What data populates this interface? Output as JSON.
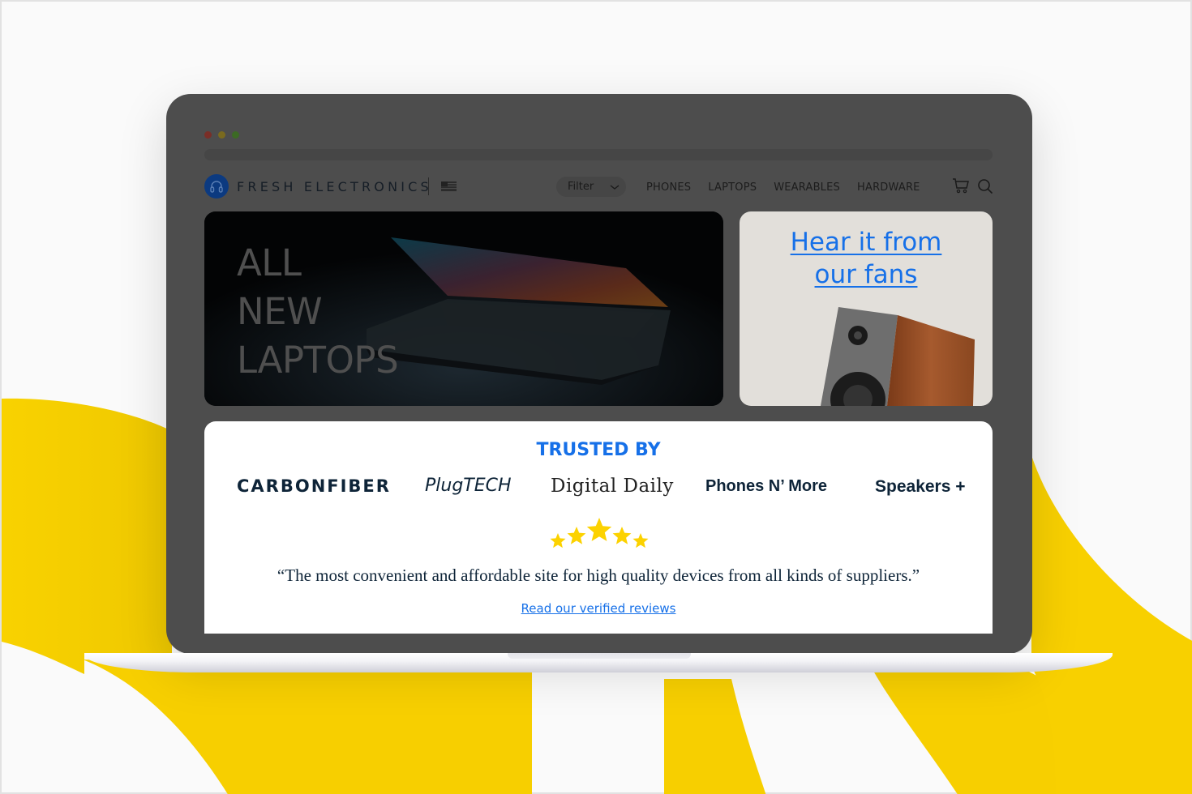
{
  "colors": {
    "accent_blue": "#1670e8",
    "brand_navy": "#0c3a80",
    "star_yellow": "#fcd200",
    "background_yellow": "#f8d000",
    "lid_gray": "#4d4d4d"
  },
  "window": {
    "traffic_lights": [
      "#7a2e27",
      "#7a6a1e",
      "#3c6a24"
    ]
  },
  "nav": {
    "logo_icon": "headphones-icon",
    "brand": "FRESH ELECTRONICS",
    "flag_icon": "us-flag-icon",
    "filter": {
      "label": "Filter",
      "icon": "chevron-down-icon"
    },
    "links": [
      "PHONES",
      "LAPTOPS",
      "WEARABLES",
      "HARDWARE"
    ],
    "cart_icon": "cart-icon",
    "search_icon": "search-icon"
  },
  "hero": {
    "lines": [
      "ALL",
      "NEW",
      "LAPTOPS"
    ],
    "image": "laptop-photo"
  },
  "fans_card": {
    "title_line1": "Hear it from",
    "title_line2": "our fans",
    "image": "speaker-photo"
  },
  "trusted": {
    "heading": "TRUSTED BY",
    "brands": [
      "CARBONFIBER",
      "PlugTECH",
      "Digital Daily",
      "Phones N’ More",
      "Speakers +"
    ],
    "rating": {
      "stars": 5,
      "max": 5
    },
    "quote": "“The most convenient and affordable site for high quality devices from all kinds of suppliers.”",
    "reviews_link": "Read our verified reviews"
  }
}
